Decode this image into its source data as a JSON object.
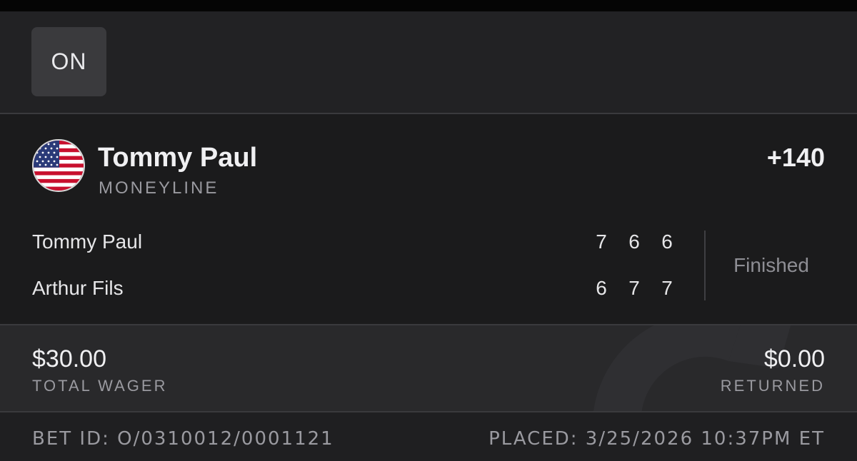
{
  "header": {
    "on_label": "ON"
  },
  "bet": {
    "player_name": "Tommy Paul",
    "market": "MONEYLINE",
    "odds": "+140",
    "flag_icon": "us-flag-icon"
  },
  "match": {
    "players": [
      {
        "name": "Tommy Paul",
        "sets": [
          "7",
          "6",
          "6"
        ]
      },
      {
        "name": "Arthur Fils",
        "sets": [
          "6",
          "7",
          "7"
        ]
      }
    ],
    "status": "Finished"
  },
  "wager": {
    "total_amount": "$30.00",
    "total_label": "TOTAL WAGER",
    "returned_amount": "$0.00",
    "returned_label": "RETURNED"
  },
  "footer": {
    "bet_id": "BET ID: O/0310012/0001121",
    "placed": "PLACED: 3/25/2026 10:37PM ET"
  },
  "colors": {
    "background": "#1b1b1c",
    "header": "#222224",
    "badge": "#3a3a3d",
    "wager_band": "#29292b",
    "muted_text": "#9a9aa0"
  }
}
